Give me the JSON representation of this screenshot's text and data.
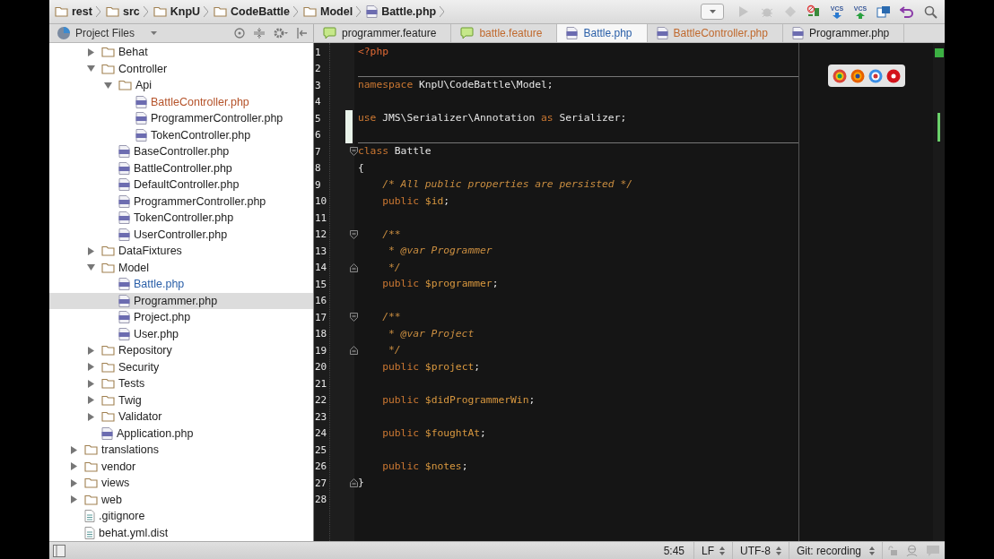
{
  "breadcrumbs": [
    {
      "label": "rest",
      "kind": "folder"
    },
    {
      "label": "src",
      "kind": "folder"
    },
    {
      "label": "KnpU",
      "kind": "folder"
    },
    {
      "label": "CodeBattle",
      "kind": "folder"
    },
    {
      "label": "Model",
      "kind": "folder"
    },
    {
      "label": "Battle.php",
      "kind": "php"
    }
  ],
  "toolbar": [
    {
      "kind": "dropdown",
      "disabled": false
    },
    {
      "kind": "run",
      "disabled": true
    },
    {
      "kind": "debug",
      "disabled": true
    },
    {
      "kind": "coverage",
      "disabled": true
    },
    {
      "kind": "listen",
      "disabled": false
    },
    {
      "kind": "vcs-update",
      "label": "VCS",
      "disabled": false
    },
    {
      "kind": "vcs-commit",
      "label": "VCS",
      "disabled": false
    },
    {
      "kind": "compare",
      "disabled": false
    },
    {
      "kind": "revert",
      "disabled": false
    },
    {
      "kind": "search",
      "disabled": false
    }
  ],
  "project_panel": {
    "title": "Project Files"
  },
  "tabs": [
    {
      "label": "programmer.feature",
      "kind": "feature",
      "selected": false
    },
    {
      "label": "battle.feature",
      "kind": "feature",
      "selected": false,
      "color": "#c0692d"
    },
    {
      "label": "Battle.php",
      "kind": "php",
      "selected": true,
      "color": "#2a5fa8"
    },
    {
      "label": "BattleController.php",
      "kind": "php",
      "selected": false,
      "color": "#c0692d"
    },
    {
      "label": "Programmer.php",
      "kind": "php",
      "selected": false
    }
  ],
  "tree": {
    "continued": [
      {
        "label": "Behat",
        "kind": "folder",
        "expanded": false,
        "selected": false
      },
      {
        "label": "Controller",
        "kind": "folder",
        "expanded": true,
        "selected": false,
        "children": [
          {
            "label": "Api",
            "kind": "folder",
            "expanded": true,
            "selected": false,
            "children": [
              {
                "label": "BattleController.php",
                "kind": "php",
                "selected": false,
                "color": "#b5532a"
              },
              {
                "label": "ProgrammerController.php",
                "kind": "php",
                "selected": false
              },
              {
                "label": "TokenController.php",
                "kind": "php",
                "selected": false
              }
            ]
          },
          {
            "label": "BaseController.php",
            "kind": "php",
            "selected": false
          },
          {
            "label": "BattleController.php",
            "kind": "php",
            "selected": false
          },
          {
            "label": "DefaultController.php",
            "kind": "php",
            "selected": false
          },
          {
            "label": "ProgrammerController.php",
            "kind": "php",
            "selected": false
          },
          {
            "label": "TokenController.php",
            "kind": "php",
            "selected": false
          },
          {
            "label": "UserController.php",
            "kind": "php",
            "selected": false
          }
        ]
      },
      {
        "label": "DataFixtures",
        "kind": "folder",
        "expanded": false,
        "selected": false
      },
      {
        "label": "Model",
        "kind": "folder",
        "expanded": true,
        "selected": false,
        "children": [
          {
            "label": "Battle.php",
            "kind": "php",
            "selected": false,
            "color": "#2a5fa8"
          },
          {
            "label": "Programmer.php",
            "kind": "php",
            "selected": true
          },
          {
            "label": "Project.php",
            "kind": "php",
            "selected": false
          },
          {
            "label": "User.php",
            "kind": "php",
            "selected": false
          }
        ]
      },
      {
        "label": "Repository",
        "kind": "folder",
        "expanded": false,
        "selected": false
      },
      {
        "label": "Security",
        "kind": "folder",
        "expanded": false,
        "selected": false
      },
      {
        "label": "Tests",
        "kind": "folder",
        "expanded": false,
        "selected": false
      },
      {
        "label": "Twig",
        "kind": "folder",
        "expanded": false,
        "selected": false
      },
      {
        "label": "Validator",
        "kind": "folder",
        "expanded": false,
        "selected": false
      },
      {
        "label": "Application.php",
        "kind": "php",
        "selected": false
      }
    ],
    "items": [
      {
        "label": "translations",
        "kind": "folder",
        "expanded": false,
        "selected": false
      },
      {
        "label": "vendor",
        "kind": "folder",
        "expanded": false,
        "selected": false
      },
      {
        "label": "views",
        "kind": "folder",
        "expanded": false,
        "selected": false
      },
      {
        "label": "web",
        "kind": "folder",
        "expanded": false,
        "selected": false
      },
      {
        "label": ".gitignore",
        "kind": "text",
        "selected": false
      },
      {
        "label": "behat.yml.dist",
        "kind": "text",
        "selected": false
      }
    ]
  },
  "editor": {
    "lines": [
      {
        "number": "1",
        "tokens": [
          {
            "kind": "tag",
            "text": "<?php"
          }
        ]
      },
      {
        "number": "2",
        "separator_after": true
      },
      {
        "number": "3",
        "tokens": [
          {
            "kind": "kw",
            "text": "namespace"
          },
          {
            "kind": "text",
            "text": " KnpU\\CodeBattle\\Model;"
          }
        ]
      },
      {
        "number": "4"
      },
      {
        "number": "5",
        "changed": true,
        "tokens": [
          {
            "kind": "kw",
            "text": "use"
          },
          {
            "kind": "text",
            "text": " JMS\\Serializer\\Annotation "
          },
          {
            "kind": "kw",
            "text": "as"
          },
          {
            "kind": "text",
            "text": " Serializer;"
          }
        ]
      },
      {
        "number": "6",
        "changed": true,
        "separator_after": true
      },
      {
        "number": "7",
        "fold_start": true,
        "tokens": [
          {
            "kind": "kw",
            "text": "class"
          },
          {
            "kind": "text",
            "text": " Battle"
          }
        ]
      },
      {
        "number": "8",
        "tokens": [
          {
            "kind": "text",
            "text": "{"
          }
        ]
      },
      {
        "number": "9",
        "tokens": [
          {
            "kind": "comment",
            "text": "    /* All public properties are persisted */"
          }
        ]
      },
      {
        "number": "10",
        "tokens": [
          {
            "kind": "kw",
            "text": "    public "
          },
          {
            "kind": "var",
            "text": "$id"
          },
          {
            "kind": "text",
            "text": ";"
          }
        ]
      },
      {
        "number": "11"
      },
      {
        "number": "12",
        "fold_start": true,
        "tokens": [
          {
            "kind": "comment",
            "text": "    /**"
          }
        ]
      },
      {
        "number": "13",
        "tokens": [
          {
            "kind": "comment",
            "text": "     * @var Programmer"
          }
        ]
      },
      {
        "number": "14",
        "fold_end": true,
        "tokens": [
          {
            "kind": "comment",
            "text": "     */"
          }
        ]
      },
      {
        "number": "15",
        "tokens": [
          {
            "kind": "kw",
            "text": "    public "
          },
          {
            "kind": "var",
            "text": "$programmer"
          },
          {
            "kind": "text",
            "text": ";"
          }
        ]
      },
      {
        "number": "16"
      },
      {
        "number": "17",
        "fold_start": true,
        "tokens": [
          {
            "kind": "comment",
            "text": "    /**"
          }
        ]
      },
      {
        "number": "18",
        "tokens": [
          {
            "kind": "comment",
            "text": "     * @var Project"
          }
        ]
      },
      {
        "number": "19",
        "fold_end": true,
        "tokens": [
          {
            "kind": "comment",
            "text": "     */"
          }
        ]
      },
      {
        "number": "20",
        "tokens": [
          {
            "kind": "kw",
            "text": "    public "
          },
          {
            "kind": "var",
            "text": "$project"
          },
          {
            "kind": "text",
            "text": ";"
          }
        ]
      },
      {
        "number": "21"
      },
      {
        "number": "22",
        "tokens": [
          {
            "kind": "kw",
            "text": "    public "
          },
          {
            "kind": "var",
            "text": "$didProgrammerWin"
          },
          {
            "kind": "text",
            "text": ";"
          }
        ]
      },
      {
        "number": "23"
      },
      {
        "number": "24",
        "tokens": [
          {
            "kind": "kw",
            "text": "    public "
          },
          {
            "kind": "var",
            "text": "$foughtAt"
          },
          {
            "kind": "text",
            "text": ";"
          }
        ]
      },
      {
        "number": "25"
      },
      {
        "number": "26",
        "tokens": [
          {
            "kind": "kw",
            "text": "    public "
          },
          {
            "kind": "var",
            "text": "$notes"
          },
          {
            "kind": "text",
            "text": ";"
          }
        ]
      },
      {
        "number": "27",
        "fold_end": true,
        "tokens": [
          {
            "kind": "text",
            "text": "}"
          }
        ]
      },
      {
        "number": "28"
      }
    ]
  },
  "browsers": [
    {
      "kind": "chrome"
    },
    {
      "kind": "firefox"
    },
    {
      "kind": "safari"
    },
    {
      "kind": "opera"
    }
  ],
  "status_bar": {
    "position": "5:45",
    "line_separator": "LF",
    "encoding": "UTF-8",
    "vcs": "Git: recording"
  }
}
